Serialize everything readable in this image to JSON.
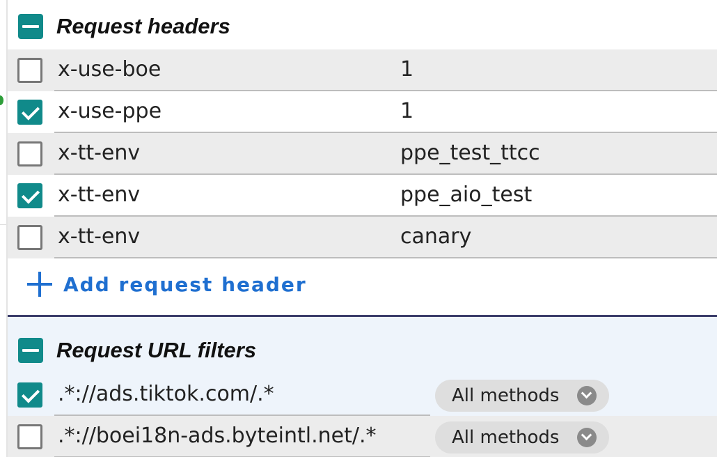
{
  "request_headers": {
    "title": "Request headers",
    "add_label": "Add request header",
    "rows": [
      {
        "name": "x-use-boe",
        "value": "1",
        "checked": false
      },
      {
        "name": "x-use-ppe",
        "value": "1",
        "checked": true
      },
      {
        "name": "x-tt-env",
        "value": "ppe_test_ttcc",
        "checked": false
      },
      {
        "name": "x-tt-env",
        "value": "ppe_aio_test",
        "checked": true
      },
      {
        "name": "x-tt-env",
        "value": "canary",
        "checked": false
      }
    ]
  },
  "url_filters": {
    "title": "Request URL filters",
    "rows": [
      {
        "pattern": ".*://ads.tiktok.com/.*",
        "method": "All methods",
        "checked": true
      },
      {
        "pattern": ".*://boei18n-ads.byteintl.net/.*",
        "method": "All methods",
        "checked": false
      }
    ]
  },
  "colors": {
    "accent": "#108a8a",
    "link": "#1f6fd0",
    "section_divider": "#3b3d6b"
  }
}
